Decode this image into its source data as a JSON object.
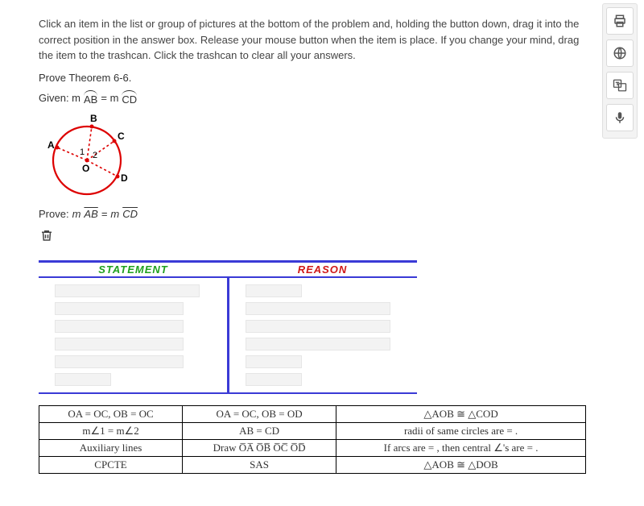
{
  "instructions": "Click an item in the list or group of pictures at the bottom of the problem and, holding the button down, drag it into the correct position in the answer box. Release your mouse button when the item is place. If you change your mind, drag the item to the trashcan. Click the trashcan to clear all your answers.",
  "task_line": "Prove Theorem 6-6.",
  "given": {
    "prefix": "Given: m",
    "arc1": "AB",
    "eq": " = m ",
    "arc2": "CD"
  },
  "figure": {
    "labels": {
      "A": "A",
      "B": "B",
      "C": "C",
      "D": "D",
      "O": "O",
      "ang1": "1",
      "ang2": "2"
    }
  },
  "prove": {
    "prefix": "Prove:",
    "lhs_m": "m",
    "lhs": "AB",
    "eq": " = ",
    "rhs_m": "m",
    "rhs": "CD"
  },
  "headers": {
    "statement": "STATEMENT",
    "reason": "REASON"
  },
  "choices": {
    "r1": [
      "OA = OC,  OB  = OC",
      "OA = OC,  OB  = OD",
      "△AOB  ≅  △COD"
    ],
    "r2": [
      "m∠1  =  m∠2",
      "AB  =  CD",
      "radii  of same circles are = ."
    ],
    "r3": [
      "Auxiliary  lines",
      "Draw O̅A̅  O̅B̅  O̅C̅  O̅D̅",
      "If arcs are = , then central ∠'s are = ."
    ],
    "r4": [
      "CPCTE",
      "SAS",
      "△AOB  ≅  △DOB"
    ]
  }
}
